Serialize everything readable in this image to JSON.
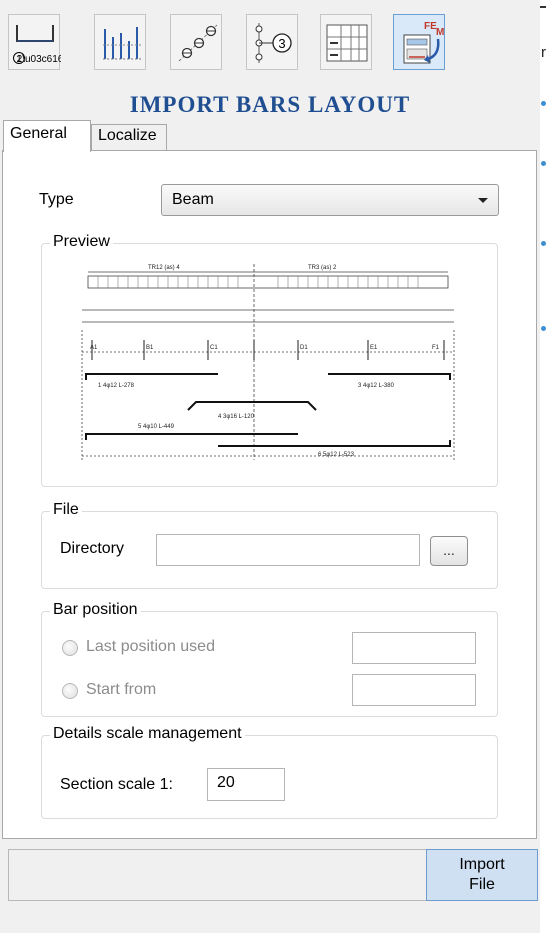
{
  "toolbar": {
    "buttons": [
      {
        "icon": "bar-shape-icon",
        "label": "① 2φ16"
      },
      {
        "icon": "bars-distribution-icon",
        "label": ""
      },
      {
        "icon": "bar-nodes-icon",
        "label": ""
      },
      {
        "icon": "bar-mark-3-icon",
        "label": "3"
      },
      {
        "icon": "bar-table-icon",
        "label": ""
      },
      {
        "icon": "import-fem-icon",
        "label": "FE M"
      }
    ]
  },
  "header": {
    "title": "IMPORT BARS LAYOUT"
  },
  "tabs": [
    {
      "label": "General",
      "active": true
    },
    {
      "label": "Localize",
      "active": false
    }
  ],
  "type_field": {
    "label": "Type",
    "value": "Beam"
  },
  "preview": {
    "legend": "Preview",
    "top_labels": [
      "TR12 (as) 4",
      "TR3 (as) 2"
    ],
    "bar_labels": [
      "1  4φ12 L-278",
      "3  4φ12 L-380",
      "4  3φ16 L-120",
      "5  4φ10 L-449",
      "6  5φ12 L-523"
    ],
    "axis_labels": [
      "A1",
      "B1",
      "C1",
      "D1",
      "E1",
      "F1"
    ]
  },
  "file": {
    "legend": "File",
    "directory_label": "Directory",
    "directory_value": "",
    "browse_label": "..."
  },
  "bar_position": {
    "legend": "Bar position",
    "options": [
      {
        "label": "Last position used",
        "value": ""
      },
      {
        "label": "Start from",
        "value": ""
      }
    ]
  },
  "scale": {
    "legend": "Details scale management",
    "label": "Section scale 1:",
    "value": "20"
  },
  "footer": {
    "import_label_line1": "Import",
    "import_label_line2": "File",
    "status_text": ""
  },
  "colors": {
    "header": "#1f4e91",
    "active_button_bg": "#d9e9f9",
    "import_button_bg": "#cfe0f3"
  }
}
